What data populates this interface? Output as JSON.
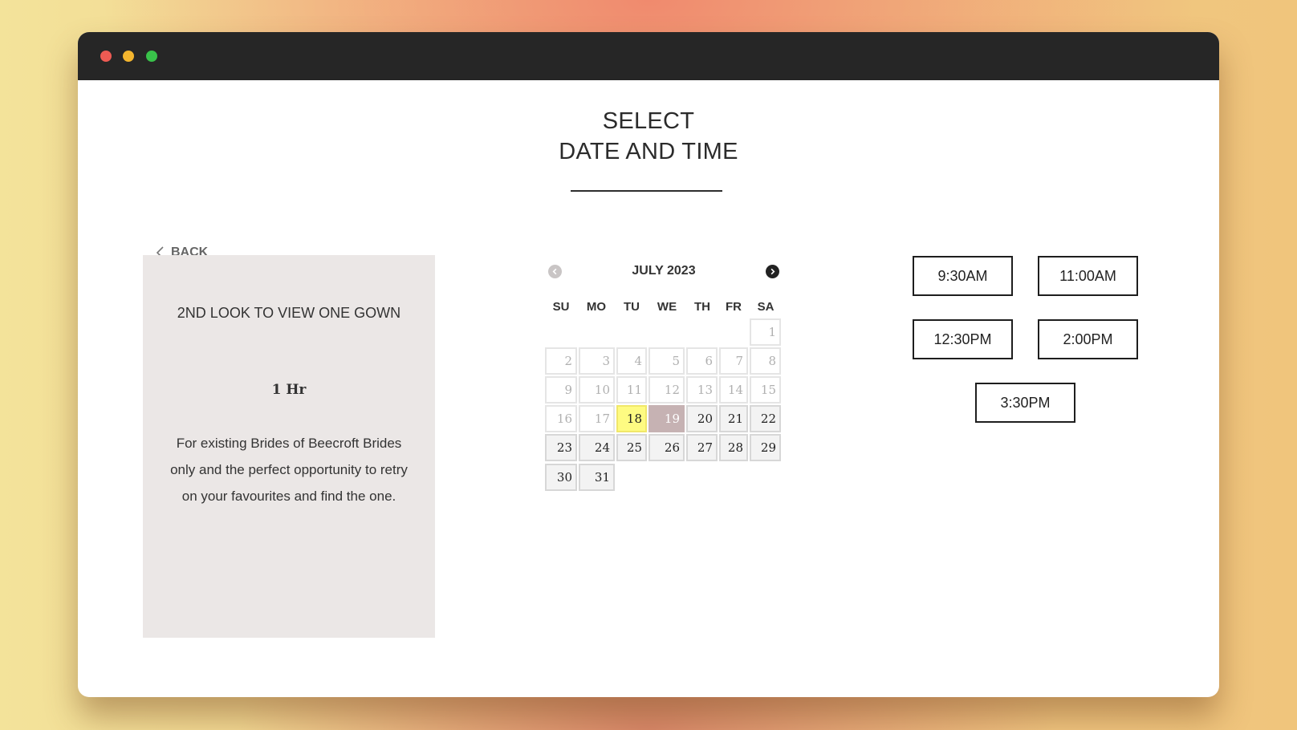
{
  "page": {
    "title_line1": "SELECT",
    "title_line2": "DATE AND TIME",
    "back_label": "BACK"
  },
  "service": {
    "name": "2ND LOOK TO VIEW ONE GOWN",
    "duration": "1 Hr",
    "description": "For existing Brides of Beecroft Brides only and the perfect opportunity to retry on your favourites and find the one."
  },
  "calendar": {
    "month_label": "JULY 2023",
    "weekdays": [
      "SU",
      "MO",
      "TU",
      "WE",
      "TH",
      "FR",
      "SA"
    ],
    "today": "18",
    "selected": "19",
    "days": [
      {
        "label": "1",
        "state": "disabled"
      },
      {
        "label": "2",
        "state": "disabled"
      },
      {
        "label": "3",
        "state": "disabled"
      },
      {
        "label": "4",
        "state": "disabled"
      },
      {
        "label": "5",
        "state": "disabled"
      },
      {
        "label": "6",
        "state": "disabled"
      },
      {
        "label": "7",
        "state": "disabled"
      },
      {
        "label": "8",
        "state": "disabled"
      },
      {
        "label": "9",
        "state": "disabled"
      },
      {
        "label": "10",
        "state": "disabled"
      },
      {
        "label": "11",
        "state": "disabled"
      },
      {
        "label": "12",
        "state": "disabled"
      },
      {
        "label": "13",
        "state": "disabled"
      },
      {
        "label": "14",
        "state": "disabled"
      },
      {
        "label": "15",
        "state": "disabled"
      },
      {
        "label": "16",
        "state": "disabled"
      },
      {
        "label": "17",
        "state": "disabled"
      },
      {
        "label": "18",
        "state": "today"
      },
      {
        "label": "19",
        "state": "selected"
      },
      {
        "label": "20",
        "state": "available"
      },
      {
        "label": "21",
        "state": "available"
      },
      {
        "label": "22",
        "state": "available"
      },
      {
        "label": "23",
        "state": "available"
      },
      {
        "label": "24",
        "state": "available"
      },
      {
        "label": "25",
        "state": "available"
      },
      {
        "label": "26",
        "state": "available"
      },
      {
        "label": "27",
        "state": "available"
      },
      {
        "label": "28",
        "state": "available"
      },
      {
        "label": "29",
        "state": "available"
      },
      {
        "label": "30",
        "state": "available"
      },
      {
        "label": "31",
        "state": "available"
      }
    ]
  },
  "time_slots": [
    "9:30AM",
    "11:00AM",
    "12:30PM",
    "2:00PM",
    "3:30PM"
  ],
  "colors": {
    "today_highlight": "#fefb82",
    "selected_day": "#c6b2b3",
    "card_background": "#ebe7e6"
  }
}
